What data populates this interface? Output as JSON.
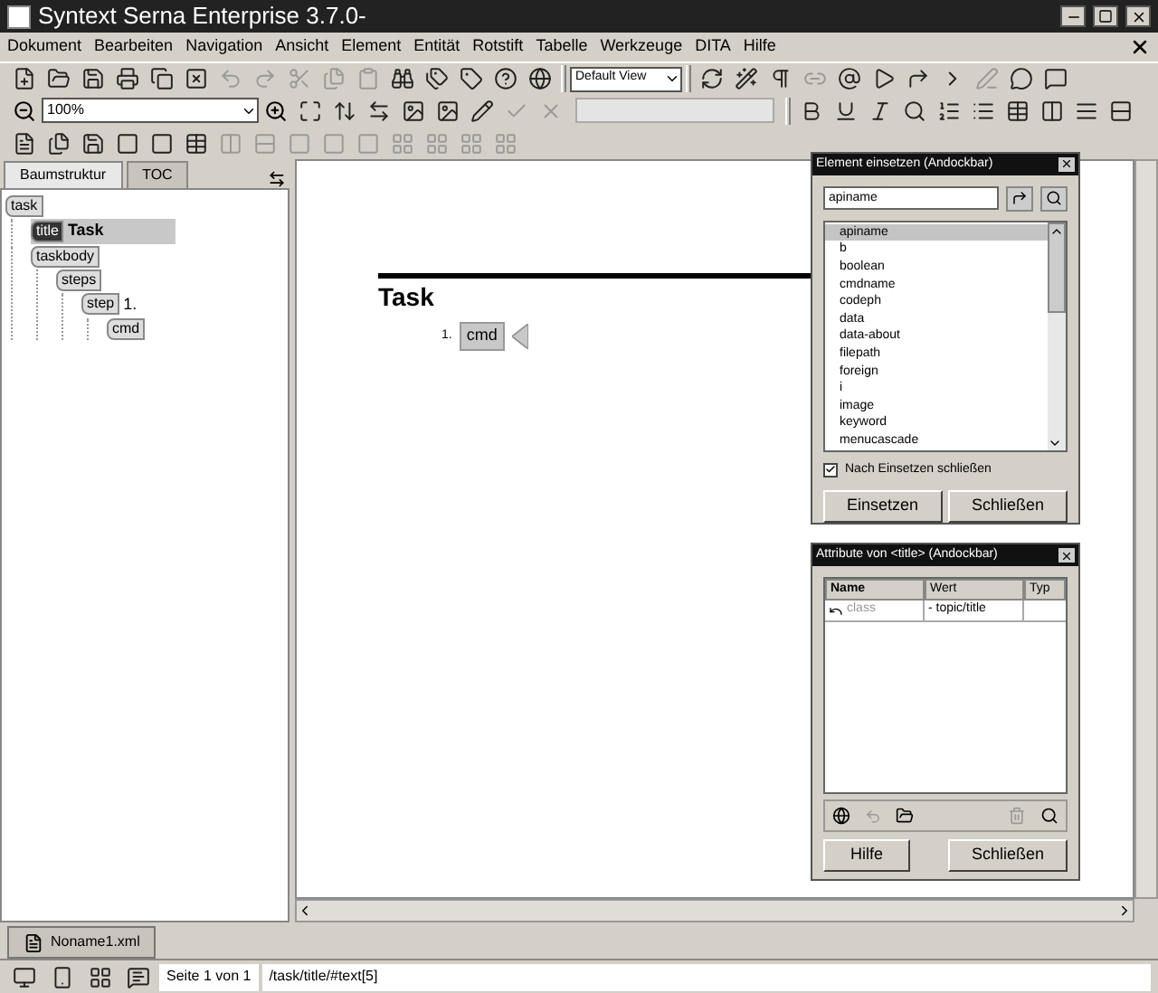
{
  "window": {
    "title": "Syntext Serna Enterprise 3.7.0-"
  },
  "menu": [
    {
      "label": "Dokument"
    },
    {
      "label": "Bearbeiten"
    },
    {
      "label": "Navigation"
    },
    {
      "label": "Ansicht"
    },
    {
      "label": "Element"
    },
    {
      "label": "Entität"
    },
    {
      "label": "Rotstift"
    },
    {
      "label": "Tabelle"
    },
    {
      "label": "Werkzeuge"
    },
    {
      "label": "DITA"
    },
    {
      "label": "Hilfe"
    }
  ],
  "view_select": {
    "value": "Default View"
  },
  "zoom_select": {
    "value": "100%"
  },
  "side_tabs": [
    {
      "label": "Baumstruktur",
      "selected": true
    },
    {
      "label": "TOC",
      "selected": false
    }
  ],
  "tree": [
    {
      "tag": "task",
      "selected": false,
      "children": [
        {
          "tag": "title",
          "text": "Task",
          "selected": true
        },
        {
          "tag": "taskbody",
          "selected": false,
          "children": [
            {
              "tag": "steps",
              "selected": false,
              "children": [
                {
                  "tag": "step",
                  "text": "1.",
                  "selected": false,
                  "children": [
                    {
                      "tag": "cmd",
                      "selected": false
                    }
                  ]
                }
              ]
            }
          ]
        }
      ]
    }
  ],
  "document": {
    "heading": "Task",
    "steps": [
      {
        "number": "1.",
        "tag": "cmd"
      }
    ]
  },
  "insert_panel": {
    "title": "Element einsetzen (Andockbar)",
    "search_value": "apiname",
    "items": [
      {
        "label": "apiname",
        "selected": true
      },
      {
        "label": "b",
        "selected": false
      },
      {
        "label": "boolean",
        "selected": false
      },
      {
        "label": "cmdname",
        "selected": false
      },
      {
        "label": "codeph",
        "selected": false
      },
      {
        "label": "data",
        "selected": false
      },
      {
        "label": "data-about",
        "selected": false
      },
      {
        "label": "filepath",
        "selected": false
      },
      {
        "label": "foreign",
        "selected": false
      },
      {
        "label": "i",
        "selected": false
      },
      {
        "label": "image",
        "selected": false
      },
      {
        "label": "keyword",
        "selected": false
      },
      {
        "label": "menucascade",
        "selected": false
      }
    ],
    "close_after_insert": {
      "label": "Nach Einsetzen schließen",
      "checked": true
    },
    "buttons": [
      {
        "label": "Einsetzen"
      },
      {
        "label": "Schließen"
      }
    ]
  },
  "attr_panel": {
    "title": "Attribute von <title> (Andockbar)",
    "columns": [
      "Name",
      "Wert",
      "Typ"
    ],
    "rows": [
      {
        "name": "class",
        "value": "- topic/title"
      }
    ],
    "buttons": [
      {
        "label": "Hilfe"
      },
      {
        "label": "Schließen"
      }
    ]
  },
  "doc_tabs": [
    {
      "label": "Noname1.xml",
      "selected": true
    }
  ],
  "status_bar": {
    "page": "Seite 1 von 1",
    "path": "/task/title/#text[5]"
  }
}
